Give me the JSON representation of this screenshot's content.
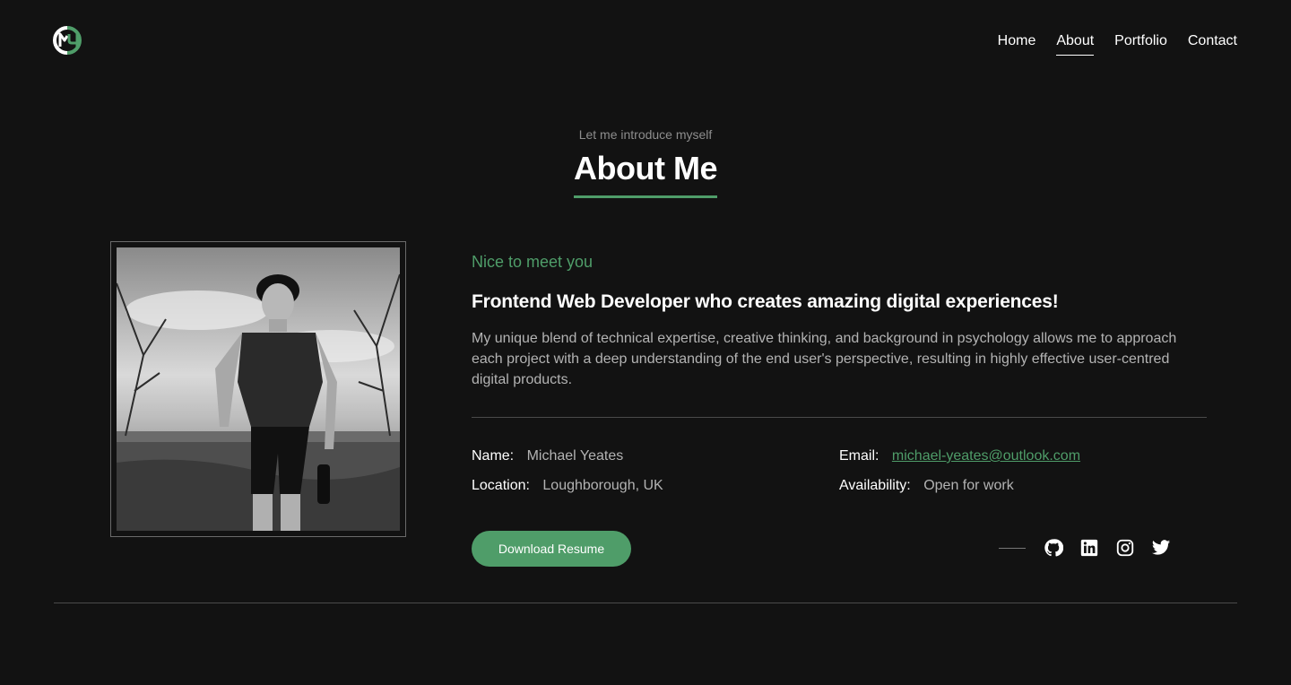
{
  "header": {
    "logo_label": "MY",
    "nav": [
      {
        "label": "Home",
        "active": false
      },
      {
        "label": "About",
        "active": true
      },
      {
        "label": "Portfolio",
        "active": false
      },
      {
        "label": "Contact",
        "active": false
      }
    ]
  },
  "about": {
    "kicker": "Let me introduce myself",
    "title": "About Me",
    "greeting": "Nice to meet you",
    "headline": "Frontend Web Developer who creates amazing digital experiences!",
    "bio": "My unique blend of technical expertise, creative thinking, and background in psychology allows me to approach each project with a deep understanding of the end user's perspective, resulting in highly effective user-centred digital products.",
    "info": {
      "name_label": "Name:",
      "name_value": "Michael Yeates",
      "email_label": "Email:",
      "email_value": "michael-yeates@outlook.com",
      "location_label": "Location:",
      "location_value": "Loughborough, UK",
      "availability_label": "Availability:",
      "availability_value": "Open for work"
    },
    "download_label": "Download Resume",
    "socials": [
      "github-icon",
      "linkedin-icon",
      "instagram-icon",
      "twitter-icon"
    ]
  },
  "colors": {
    "background": "#121212",
    "accent": "#4f9d69",
    "muted_text": "#b3b3b3"
  }
}
